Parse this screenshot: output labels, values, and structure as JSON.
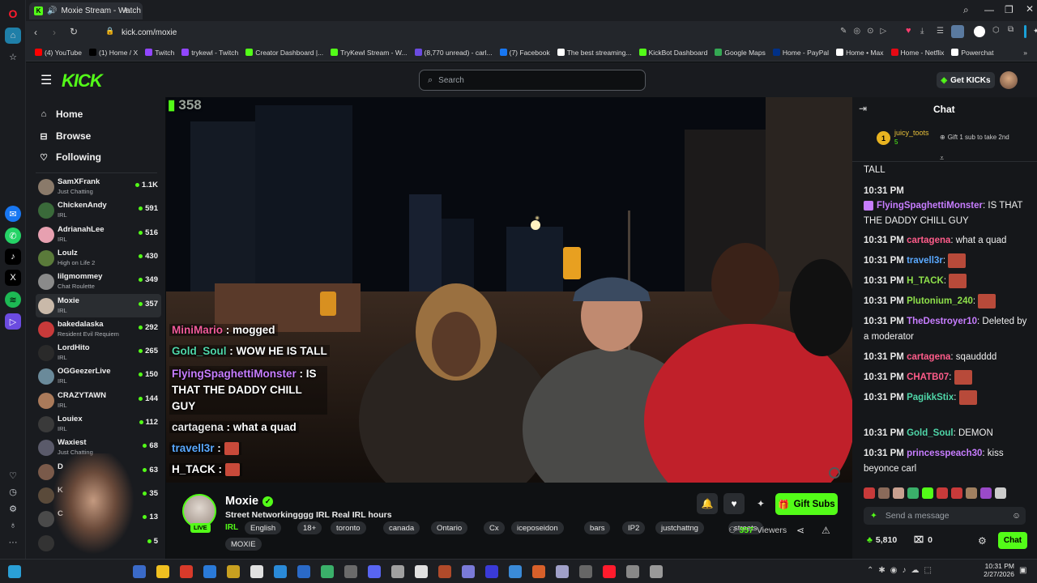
{
  "browser": {
    "tab_title": "Moxie Stream - Watch",
    "url": "kick.com/moxie",
    "ai_label": "AI"
  },
  "bookmarks": [
    {
      "label": "(4) YouTube",
      "color": "#ff0000"
    },
    {
      "label": "(1) Home / X",
      "color": "#000000"
    },
    {
      "label": "Twitch",
      "color": "#9146ff"
    },
    {
      "label": "trykewl - Twitch",
      "color": "#9146ff"
    },
    {
      "label": "Creator Dashboard |...",
      "color": "#53fc18"
    },
    {
      "label": "TryKewl Stream - W...",
      "color": "#53fc18"
    },
    {
      "label": "(8,770 unread) - carl...",
      "color": "#6b4be0"
    },
    {
      "label": "(7) Facebook",
      "color": "#1877f2"
    },
    {
      "label": "The best streaming...",
      "color": "#ffffff"
    },
    {
      "label": "KickBot Dashboard",
      "color": "#53fc18"
    },
    {
      "label": "Google Maps",
      "color": "#34a853"
    },
    {
      "label": "Home - PayPal",
      "color": "#003087"
    },
    {
      "label": "Home • Max",
      "color": "#ffffff"
    },
    {
      "label": "Home - Netflix",
      "color": "#e50914"
    },
    {
      "label": "Powerchat",
      "color": "#ffffff"
    }
  ],
  "header": {
    "logo": "KICK",
    "search_placeholder": "Search",
    "get_kicks": "Get KICKs"
  },
  "nav": {
    "home": "Home",
    "browse": "Browse",
    "following": "Following"
  },
  "channels": [
    {
      "name": "SamXFrank",
      "sub": "Just Chatting",
      "viewers": "1.1K",
      "color": "#8a7a6a"
    },
    {
      "name": "ChickenAndy",
      "sub": "IRL",
      "viewers": "591",
      "color": "#3a6a3a"
    },
    {
      "name": "AdrianahLee",
      "sub": "IRL",
      "viewers": "516",
      "color": "#e7a0b0"
    },
    {
      "name": "Loulz",
      "sub": "High on Life 2",
      "viewers": "430",
      "color": "#5a7a3a"
    },
    {
      "name": "lilgmommey",
      "sub": "Chat Roulette",
      "viewers": "349",
      "color": "#8a8a8a"
    },
    {
      "name": "Moxie",
      "sub": "IRL",
      "viewers": "357",
      "color": "#c9b9a9",
      "active": true
    },
    {
      "name": "bakedalaska",
      "sub": "Resident Evil Requiem",
      "viewers": "292",
      "color": "#c83a3a"
    },
    {
      "name": "LordHito",
      "sub": "IRL",
      "viewers": "265",
      "color": "#2a2a2a"
    },
    {
      "name": "OGGeezerLive",
      "sub": "IRL",
      "viewers": "150",
      "color": "#6a8a9a"
    },
    {
      "name": "CRAZYTAWN",
      "sub": "IRL",
      "viewers": "144",
      "color": "#aa7a5a"
    },
    {
      "name": "Louiex",
      "sub": "IRL",
      "viewers": "112",
      "color": "#3a3a3a"
    },
    {
      "name": "Waxiest",
      "sub": "Just Chatting",
      "viewers": "68",
      "color": "#5a5a6a"
    },
    {
      "name": "D",
      "sub": "",
      "viewers": "63",
      "color": "#7a5a4a"
    },
    {
      "name": "K",
      "sub": "",
      "viewers": "35",
      "color": "#5a4a3a"
    },
    {
      "name": "C",
      "sub": "",
      "viewers": "13",
      "color": "#4a4a4a"
    },
    {
      "name": "",
      "sub": "",
      "viewers": "5",
      "color": "#333333"
    }
  ],
  "video": {
    "viewer_overlay": "358",
    "overlay_chat": [
      {
        "user": "MiniMario",
        "user_color": "#f25c9b",
        "text": "mogged"
      },
      {
        "user": "Gold_Soul",
        "user_color": "#4fd6a8",
        "text": "WOW HE IS TALL"
      },
      {
        "user": "FlyingSpaghettiMonster",
        "user_color": "#c77dff",
        "text": "IS THAT THE DADDY CHILL GUY"
      },
      {
        "user": "cartagena",
        "user_color": "#e6e6e6",
        "text": "what a quad"
      },
      {
        "user": "travell3r",
        "user_color": "#5aa9ff",
        "text": ""
      },
      {
        "user": "H_TACK",
        "user_color": "#ffffff",
        "text": ""
      }
    ]
  },
  "stream": {
    "streamer": "Moxie",
    "title": "Street Networkingggg IRL Real IRL hours",
    "live_badge": "LIVE",
    "category": "IRL",
    "tags": [
      "English",
      "18+",
      "toronto",
      "canada",
      "Ontario",
      "Cx",
      "iceposeidon",
      "bars",
      "IP2",
      "justchattng",
      "streets",
      "MOXIE"
    ],
    "viewers": "357",
    "viewers_label": "Viewers",
    "gift_subs": "Gift Subs"
  },
  "chat": {
    "title": "Chat",
    "pinned": {
      "rank": "1",
      "user": "juicy_toots",
      "amount": "5",
      "gift_hint": "Gift 1 sub to take 2nd"
    },
    "first_line": "TALL",
    "messages": [
      {
        "time": "10:31 PM",
        "user": "",
        "color": "#f0f0f0",
        "text": ""
      },
      {
        "time": "",
        "user": "FlyingSpaghettiMonster",
        "color": "#c77dff",
        "text": "IS THAT THE DADDY CHILL GUY"
      },
      {
        "time": "10:31 PM",
        "user": "cartagena",
        "color": "#ff5c8a",
        "text": "what a quad"
      },
      {
        "time": "10:31 PM",
        "user": "travell3r",
        "color": "#5aa9ff",
        "text": ""
      },
      {
        "time": "10:31 PM",
        "user": "H_TACK",
        "color": "#8ee04a",
        "text": ""
      },
      {
        "time": "10:31 PM",
        "user": "Plutonium_240",
        "color": "#8ee04a",
        "text": ""
      },
      {
        "time": "10:31 PM",
        "user": "TheDestroyer10",
        "color": "#c77dff",
        "text": "Deleted by a moderator"
      },
      {
        "time": "10:31 PM",
        "user": "cartagena",
        "color": "#ff5c8a",
        "text": "sqaudddd"
      },
      {
        "time": "10:31 PM",
        "user": "CHATB07",
        "color": "#ff5c8a",
        "text": ""
      },
      {
        "time": "10:31 PM",
        "user": "PagikkStix",
        "color": "#4fd6a8",
        "text": ""
      },
      {
        "time": "10:31 PM",
        "user": "Gold_Soul",
        "color": "#4fd6a8",
        "text": "DEMON"
      },
      {
        "time": "10:31 PM",
        "user": "princesspeach30",
        "color": "#c77dff",
        "text": "kiss beyonce carl"
      }
    ],
    "send_placeholder": "Send a message",
    "points": "5,810",
    "drops": "0",
    "chat_button": "Chat"
  },
  "taskbar": {
    "time": "10:31 PM",
    "date": "2/27/2026"
  },
  "colors": {
    "accent": "#53fc18",
    "bg": "#0b0e0f",
    "panel": "#191b1f"
  }
}
